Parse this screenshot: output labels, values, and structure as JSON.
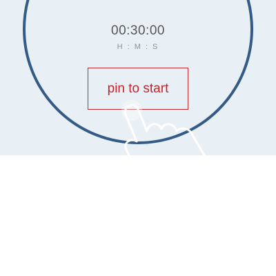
{
  "timer": {
    "display": "00:30:00",
    "units": "H : M : S"
  },
  "start_button": {
    "label": "pin to start"
  },
  "colors": {
    "ring": "#345a86",
    "accent": "#c0242c",
    "panel_background": "#e9f0f5"
  },
  "icons": {
    "hint": "tap-hand-icon"
  }
}
